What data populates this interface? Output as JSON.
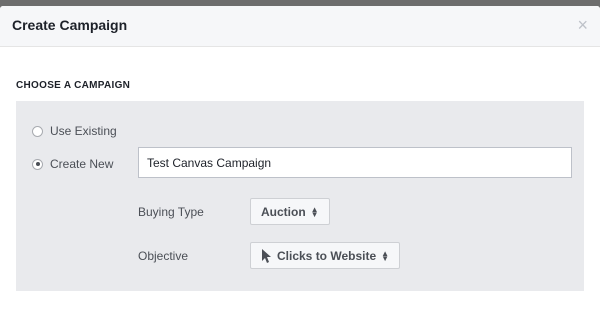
{
  "dialog": {
    "title": "Create Campaign",
    "close_glyph": "×"
  },
  "section": {
    "heading": "CHOOSE A CAMPAIGN"
  },
  "campaign_choice": {
    "options": [
      {
        "label": "Use Existing",
        "selected": false
      },
      {
        "label": "Create New",
        "selected": true
      }
    ]
  },
  "new_campaign": {
    "name_value": "Test Canvas Campaign"
  },
  "buying_type": {
    "label": "Buying Type",
    "selected": "Auction"
  },
  "objective": {
    "label": "Objective",
    "selected": "Clicks to Website",
    "icon": "cursor-arrow-icon"
  }
}
